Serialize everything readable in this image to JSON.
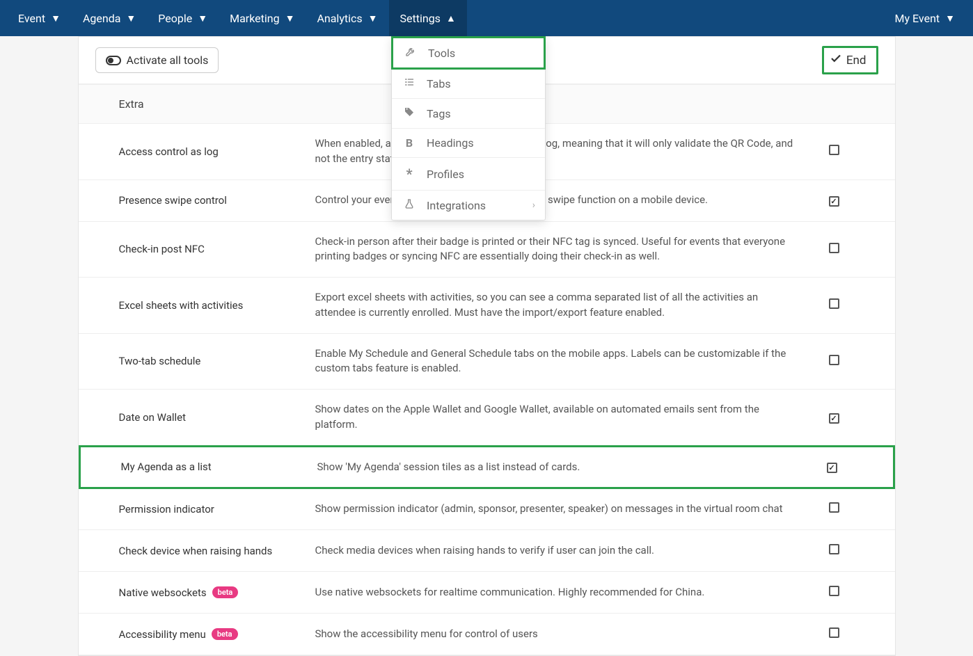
{
  "nav": {
    "items": [
      {
        "label": "Event",
        "open": false
      },
      {
        "label": "Agenda",
        "open": false
      },
      {
        "label": "People",
        "open": false
      },
      {
        "label": "Marketing",
        "open": false
      },
      {
        "label": "Analytics",
        "open": false
      },
      {
        "label": "Settings",
        "open": true
      }
    ],
    "right": {
      "label": "My Event"
    }
  },
  "toolbar": {
    "activate_label": "Activate all tools",
    "end_label": "End"
  },
  "dropdown": {
    "items": [
      {
        "label": "Tools",
        "icon": "wrench-icon",
        "highlighted": true
      },
      {
        "label": "Tabs",
        "icon": "list-icon"
      },
      {
        "label": "Tags",
        "icon": "tags-icon"
      },
      {
        "label": "Headings",
        "icon": "bold-icon"
      },
      {
        "label": "Profiles",
        "icon": "asterisk-icon"
      },
      {
        "label": "Integrations",
        "icon": "flask-icon",
        "submenu": true
      }
    ]
  },
  "section": {
    "title": "Extra"
  },
  "rows": [
    {
      "name": "Access control as log",
      "desc": "When enabled, access control will also work as a log, meaning that it will only validate the QR Code, and not the entry status of the participant.",
      "checked": false
    },
    {
      "name": "Presence swipe control",
      "desc": "Control your event and activity presence using the swipe function on a mobile device.",
      "checked": true
    },
    {
      "name": "Check-in post NFC",
      "desc": "Check-in person after their badge is printed or their NFC tag is synced. Useful for events that everyone printing badges or syncing NFC are essentially doing their check-in as well.",
      "checked": false
    },
    {
      "name": "Excel sheets with activities",
      "desc": "Export excel sheets with activities, so you can see a comma separated list of all the activities an attendee is currently enrolled. Must have the import/export feature enabled.",
      "checked": false
    },
    {
      "name": "Two-tab schedule",
      "desc": "Enable My Schedule and General Schedule tabs on the mobile apps. Labels can be customizable if the custom tabs feature is enabled.",
      "checked": false
    },
    {
      "name": "Date on Wallet",
      "desc": "Show dates on the Apple Wallet and Google Wallet, available on automated emails sent from the platform.",
      "checked": true
    },
    {
      "name": "My Agenda as a list",
      "desc": "Show 'My Agenda' session tiles as a list instead of cards.",
      "checked": true,
      "highlighted": true
    },
    {
      "name": "Permission indicator",
      "desc": "Show permission indicator (admin, sponsor, presenter, speaker) on messages in the virtual room chat",
      "checked": false
    },
    {
      "name": "Check device when raising hands",
      "desc": "Check media devices when raising hands to verify if user can join the call.",
      "checked": false
    },
    {
      "name": "Native websockets",
      "desc": "Use native websockets for realtime communication. Highly recommended for China.",
      "checked": false,
      "badge": "beta"
    },
    {
      "name": "Accessibility menu",
      "desc": "Show the accessibility menu for control of users",
      "checked": false,
      "badge": "beta"
    }
  ]
}
